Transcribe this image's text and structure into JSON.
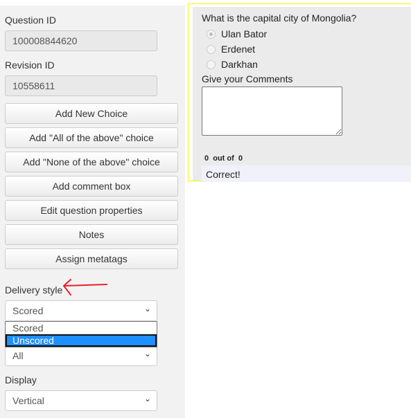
{
  "sidebar": {
    "question_id_label": "Question ID",
    "question_id": "100008844620",
    "revision_id_label": "Revision ID",
    "revision_id": "10558611",
    "buttons": [
      "Add New Choice",
      "Add \"All of the above\" choice",
      "Add \"None of the above\" choice",
      "Add comment box",
      "Edit question properties",
      "Notes",
      "Assign metatags"
    ],
    "delivery_label": "Delivery style",
    "delivery_value": "Scored",
    "delivery_options": [
      "Scored",
      "Unscored"
    ],
    "second_select_value": "All",
    "display_label": "Display",
    "display_value": "Vertical"
  },
  "preview": {
    "question": "What is the capital city of Mongolia?",
    "options": [
      "Ulan Bator",
      "Erdenet",
      "Darkhan"
    ],
    "comments_label": "Give your Comments",
    "score": "0  out of  0",
    "feedback": "Correct!"
  },
  "colors": {
    "annotation_arrow": "#e8202a",
    "highlight": "#1e90ff",
    "panel_border": "#f5f500"
  }
}
